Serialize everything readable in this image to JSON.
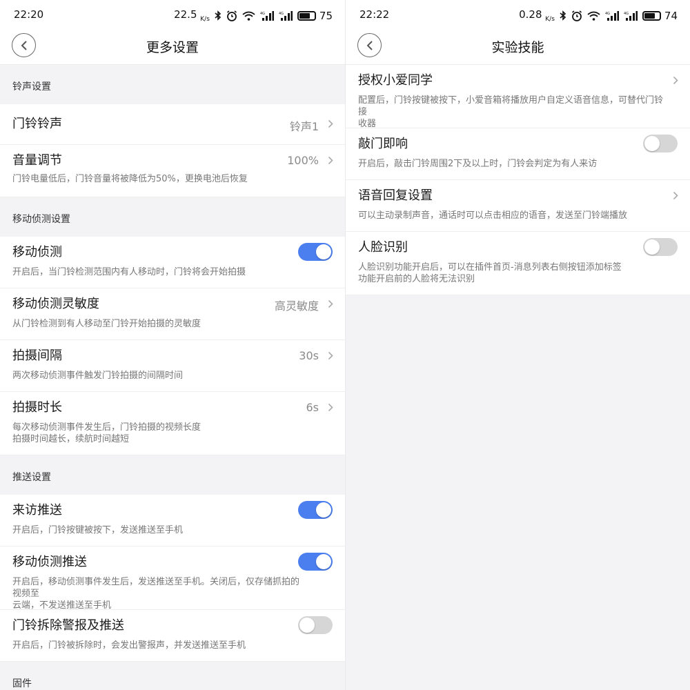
{
  "left": {
    "status": {
      "time": "22:20",
      "speed": "22.5",
      "speed_unit": "K/s",
      "battery": "75"
    },
    "title": "更多设置",
    "sections": {
      "ringtone": {
        "header": "铃声设置",
        "doorbell_ringtone": {
          "title": "门铃铃声",
          "value": "铃声1"
        },
        "volume": {
          "title": "音量调节",
          "value": "100%",
          "desc": "门铃电量低后，门铃音量将被降低为50%，更换电池后恢复"
        }
      },
      "motion": {
        "header": "移动侦测设置",
        "motion_detect": {
          "title": "移动侦测",
          "desc": "开启后，当门铃检测范围内有人移动时，门铃将会开始拍摄",
          "on": true
        },
        "sensitivity": {
          "title": "移动侦测灵敏度",
          "value": "高灵敏度",
          "desc": "从门铃检测到有人移动至门铃开始拍摄的灵敏度"
        },
        "interval": {
          "title": "拍摄间隔",
          "value": "30s",
          "desc": "两次移动侦测事件触发门铃拍摄的间隔时间"
        },
        "duration": {
          "title": "拍摄时长",
          "value": "6s",
          "desc": "每次移动侦测事件发生后，门铃拍摄的视频长度",
          "desc2": "拍摄时间越长，续航时间越短"
        }
      },
      "push": {
        "header": "推送设置",
        "visit_push": {
          "title": "来访推送",
          "desc": "开启后，门铃按键被按下，发送推送至手机",
          "on": true
        },
        "motion_push": {
          "title": "移动侦测推送",
          "desc": "开启后，移动侦测事件发生后，发送推送至手机。关闭后，仅存储抓拍的视频至",
          "desc2": "云端，不发送推送至手机",
          "on": true
        },
        "tamper_push": {
          "title": "门铃拆除警报及推送",
          "desc": "开启后，门铃被拆除时，会发出警报声，并发送推送至手机",
          "on": false
        }
      },
      "firmware": {
        "header": "固件"
      }
    }
  },
  "right": {
    "status": {
      "time": "22:22",
      "speed": "0.28",
      "speed_unit": "K/s",
      "battery": "74"
    },
    "title": "实验技能",
    "rows": {
      "xiaoai": {
        "title": "授权小爱同学",
        "desc": "配置后，门铃按键被按下，小爱音箱将播放用户自定义语音信息，可替代门铃接",
        "desc2": "收器"
      },
      "knock": {
        "title": "敲门即响",
        "desc": "开启后，敲击门铃周围2下及以上时，门铃会判定为有人来访",
        "on": false
      },
      "voice_reply": {
        "title": "语音回复设置",
        "desc": "可以主动录制声音，通话时可以点击相应的语音，发送至门铃端播放"
      },
      "face": {
        "title": "人脸识别",
        "desc": "人脸识别功能开启后，可以在插件首页-消息列表右侧按钮添加标签",
        "desc2": "功能开启前的人脸将无法识别",
        "on": false
      }
    }
  }
}
